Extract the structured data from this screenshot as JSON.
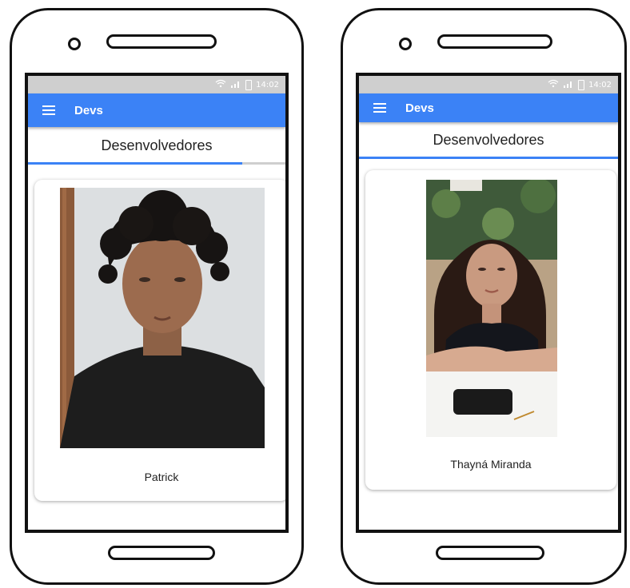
{
  "status_bar": {
    "wifi_icon": "wifi-icon",
    "signal_icon": "signal-icon",
    "battery_icon": "battery-icon",
    "time": "14:02"
  },
  "app_bar": {
    "menu_icon": "menu-icon",
    "title": "Devs"
  },
  "tab": {
    "label": "Desenvolvedores"
  },
  "phones": [
    {
      "developer": {
        "name": "Patrick"
      }
    },
    {
      "developer": {
        "name": "Thayná Miranda"
      }
    }
  ],
  "colors": {
    "accent": "#3b82f6",
    "status_bar": "#cfcfcf"
  }
}
